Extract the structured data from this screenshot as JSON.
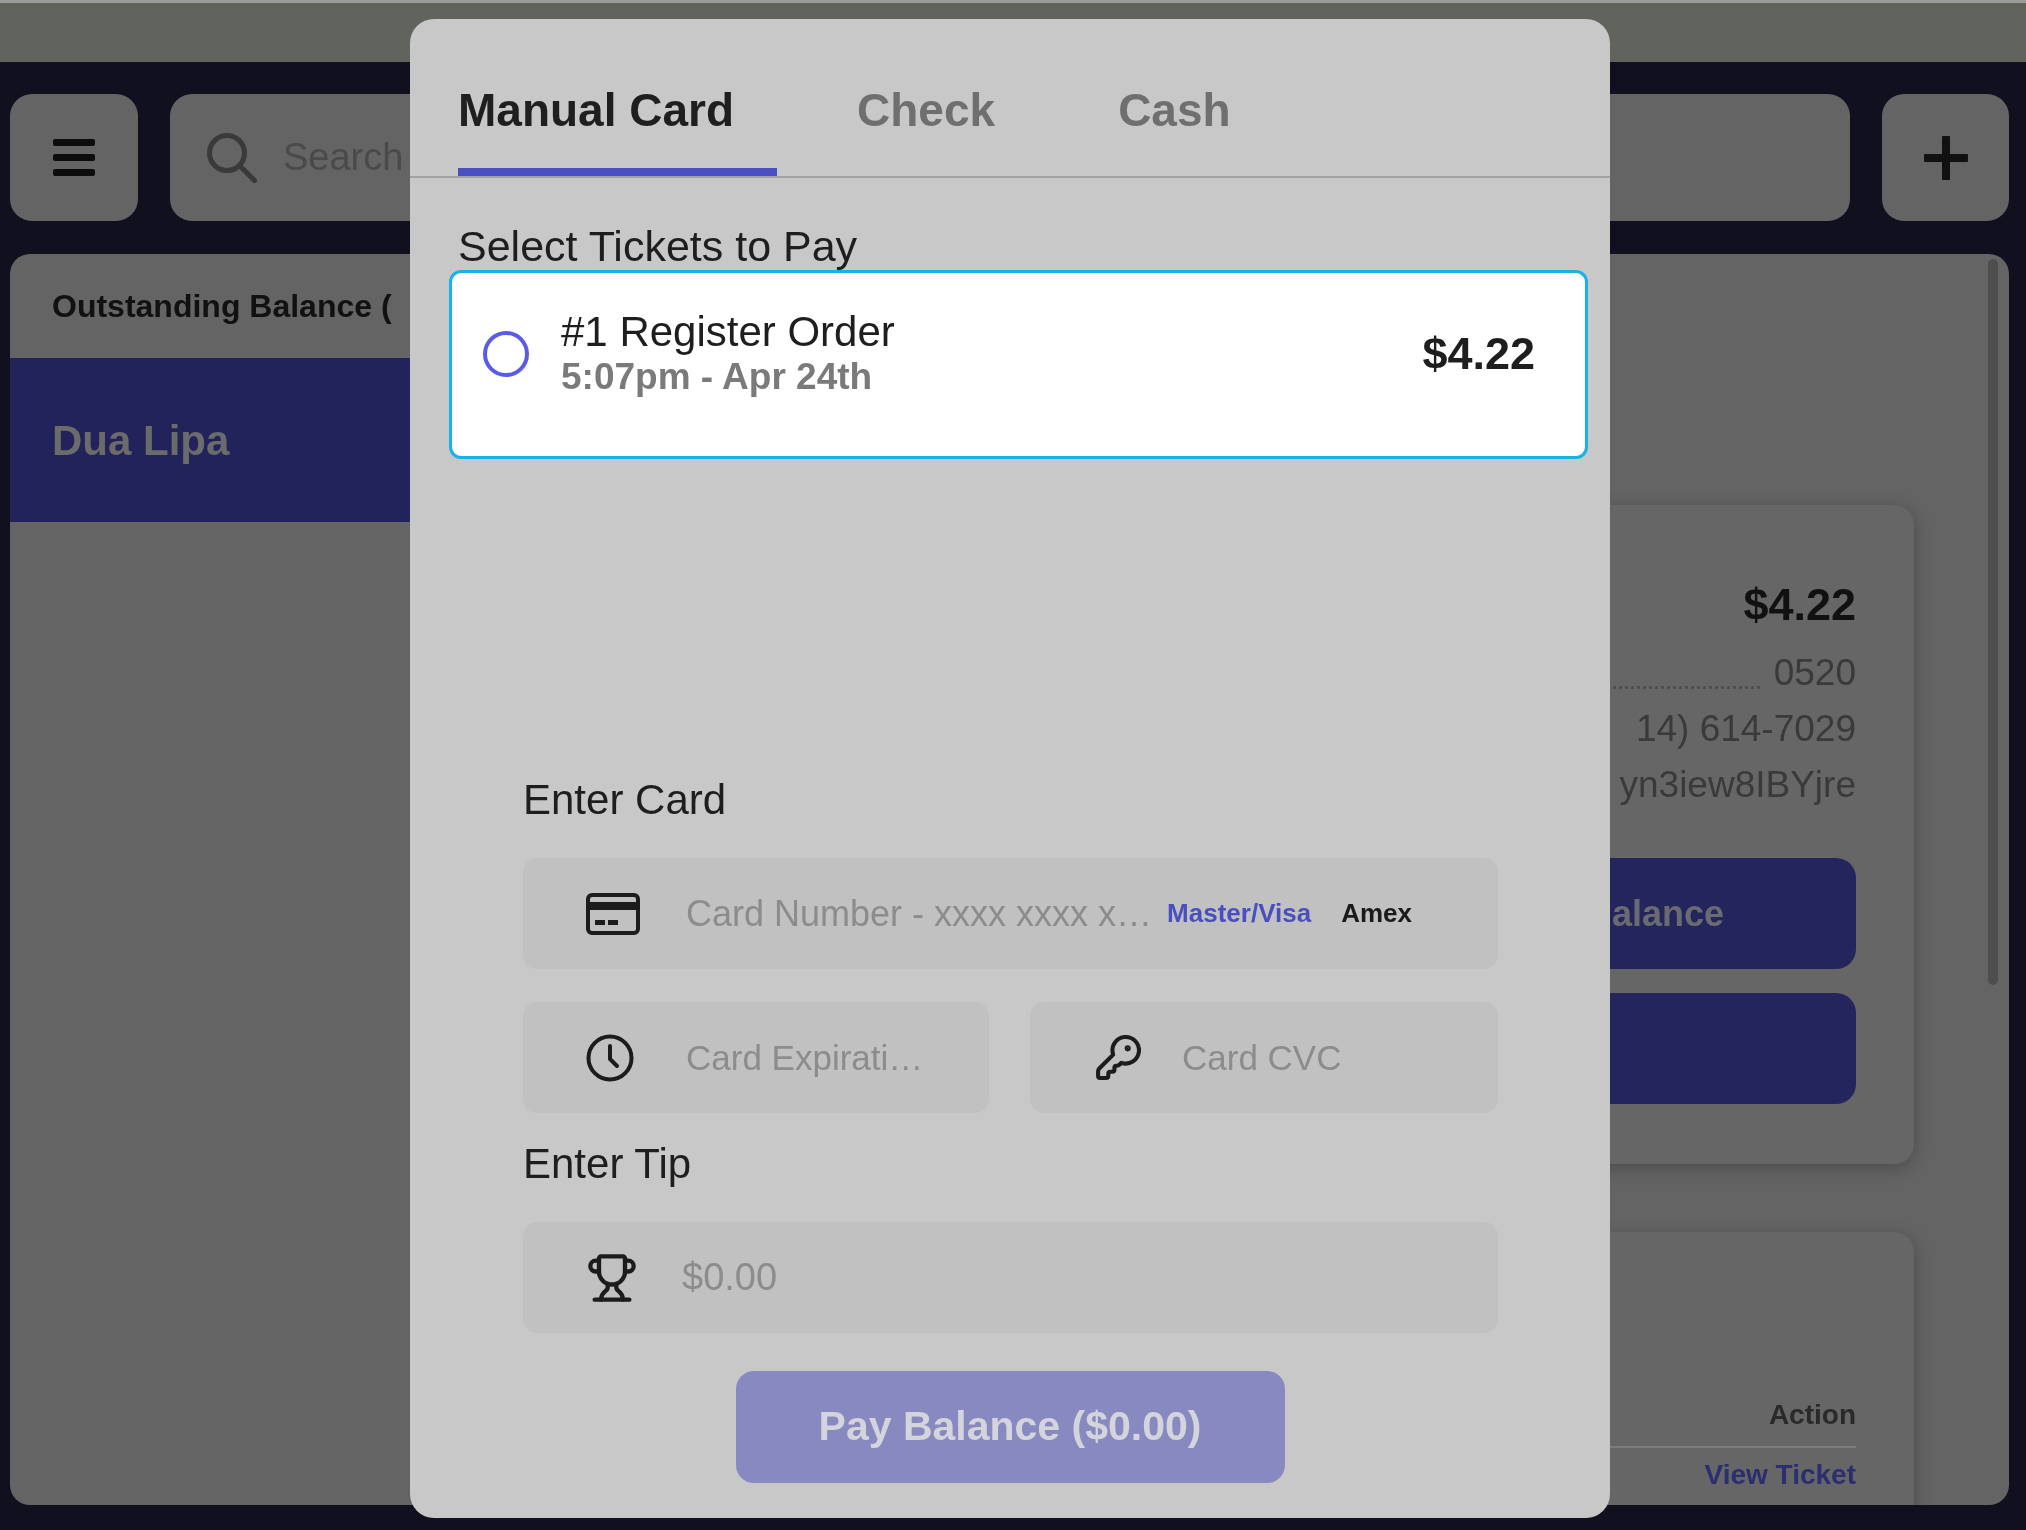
{
  "top_bar": {
    "search": {
      "placeholder": "Search"
    }
  },
  "sidebar": {
    "title": "Outstanding Balance (",
    "items": [
      {
        "name": "Dua Lipa",
        "selected": true
      }
    ]
  },
  "summary_card": {
    "total": "$4.22",
    "rows": [
      {
        "kind": "leader",
        "value": "0520"
      },
      {
        "kind": "text",
        "value": "14) 614-7029"
      },
      {
        "kind": "text",
        "value": "yn3iew8IBYjre"
      }
    ],
    "buttons": [
      {
        "label": "alance"
      }
    ]
  },
  "tickets_table": {
    "columns": [
      "Action"
    ],
    "rows": [
      [
        "View Ticket"
      ]
    ]
  },
  "modal": {
    "tabs": [
      {
        "label": "Manual Card",
        "selected": true
      },
      {
        "label": "Check",
        "selected": false
      },
      {
        "label": "Cash",
        "selected": false
      }
    ],
    "tickets_title": "Select Tickets to Pay",
    "tickets": [
      {
        "title": "#1 Register Order",
        "time": "5:07pm - Apr 24th",
        "amount": "$4.22",
        "selected": false,
        "focused": true
      }
    ],
    "card_title": "Enter Card",
    "card_number": {
      "placeholder": "Card Number - xxxx xxxx x…",
      "brands": [
        {
          "label": "Master/Visa",
          "selected": true
        },
        {
          "label": "Amex",
          "selected": false
        }
      ]
    },
    "expiration": {
      "placeholder": "Card Expirati…"
    },
    "cvc": {
      "placeholder": "Card CVC"
    },
    "tip_title": "Enter Tip",
    "tip": {
      "placeholder": "$0.00"
    },
    "pay_button": {
      "label": "Pay Balance ($0.00)",
      "disabled": true
    }
  }
}
